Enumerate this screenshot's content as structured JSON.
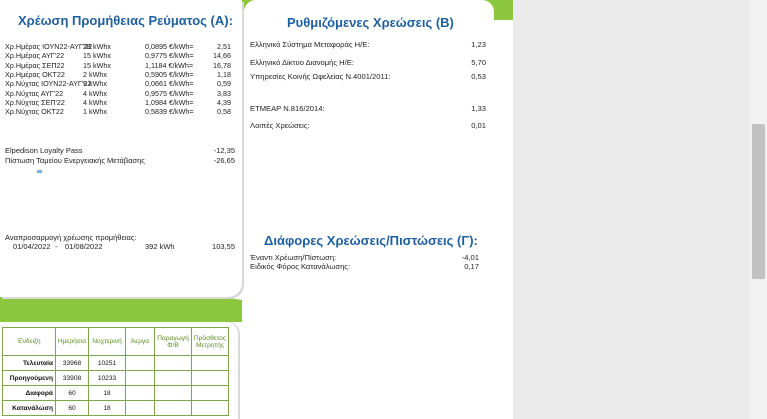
{
  "section_a": {
    "title": "Χρέωση Προμήθειας Ρεύματος (Α):",
    "rows": [
      {
        "label": "Χρ.Ημέρας ΙΟΥΝ22-ΑΥΓ'22",
        "qty": "28 kWhx",
        "price": "0,0895 €/kWh=",
        "amount": "2,51"
      },
      {
        "label": "Χρ.Ημέρας ΑΥΓ'22",
        "qty": "15 kWhx",
        "price": "0,9775 €/kWh=",
        "amount": "14,66"
      },
      {
        "label": "Χρ.Ημέρας ΣΕΠ22",
        "qty": "15 kWhx",
        "price": "1,1184 €/kWh=",
        "amount": "16,78"
      },
      {
        "label": "Χρ.Ημέρας ΟΚΤ22",
        "qty": "2 kWhx",
        "price": "0,5905 €/kWh=",
        "amount": "1,18"
      },
      {
        "label": "Χρ.Νύχτας ΙΟΥΝ22-ΑΥΓ'22",
        "qty": "9 kWhx",
        "price": "0,0661 €/kWh=",
        "amount": "0,59"
      },
      {
        "label": "Χρ.Νύχτας ΑΥΓ'22",
        "qty": "4 kWhx",
        "price": "0,9575 €/kWh=",
        "amount": "3,83"
      },
      {
        "label": "Χρ.Νύχτας ΣΕΠ'22",
        "qty": "4 kWhx",
        "price": "1,0984 €/kWh=",
        "amount": "4,39"
      },
      {
        "label": "Χρ.Νύχτας ΟΚΤ22",
        "qty": "1 kWhx",
        "price": "0,5839 €/kWh=",
        "amount": "0,58"
      }
    ],
    "loyalty_label": "Elpedison Loyalty Pass",
    "loyalty_value": "-12,35",
    "fund_label": "Πίστωση Ταμείου Ενεργειακής Μετάβασης",
    "fund_value": "-26,65",
    "readjust_label": "Αναπροσαρμογή χρέωσης προμήθειας:",
    "readjust_from": "01/04/2022",
    "readjust_dash": "-",
    "readjust_to": "01/08/2022",
    "readjust_kwh": "392 kWh",
    "readjust_value": "103,55"
  },
  "section_b": {
    "title": "Ρυθμιζόμενες Χρεώσεις (Β)",
    "rows": [
      {
        "label": "Ελληνικό Σύστημα Μεταφοράς Η/Ε:",
        "value": "1,23"
      },
      {
        "label": "Ελληνικό Δίκτυο Διανομής Η/Ε:",
        "value": "5,70"
      },
      {
        "label": "Υπηρεσίες Κοινής Ωφελείας Ν.4001/2011:",
        "value": "0,53"
      },
      {
        "label": "ΕΤΜΕΑΡ Ν.816/2014:",
        "value": "1,33"
      },
      {
        "label": "Λοιπές Χρεώσεις:",
        "value": "0,01"
      }
    ]
  },
  "section_c": {
    "title": "Διάφορες Χρεώσεις/Πιστώσεις (Γ):",
    "rows": [
      {
        "label": "Έναντι Χρέωση/Πίστωση:",
        "value": "-4,01"
      },
      {
        "label": "Ειδικός Φόρος Κατανάλωσης:",
        "value": "0,17"
      }
    ]
  },
  "meter": {
    "headers": [
      "Ένδειξη",
      "Ημερήσια",
      "Νυχτερινή",
      "Άεργα",
      "Παραγωγή Φ/Β",
      "Πρόσθετος Μετρητής"
    ],
    "rows": [
      {
        "label": "Τελευταία",
        "day": "33968",
        "night": "10251"
      },
      {
        "label": "Προηγούμενη",
        "day": "33908",
        "night": "10233"
      },
      {
        "label": "Διαφορά",
        "day": "60",
        "night": "18"
      },
      {
        "label": "Κατανάλωση",
        "day": "60",
        "night": "18"
      }
    ]
  },
  "colors": {
    "title_blue": "#1f5f9f",
    "accent_green": "#8cc63f",
    "grid_green": "#7aa84a"
  }
}
